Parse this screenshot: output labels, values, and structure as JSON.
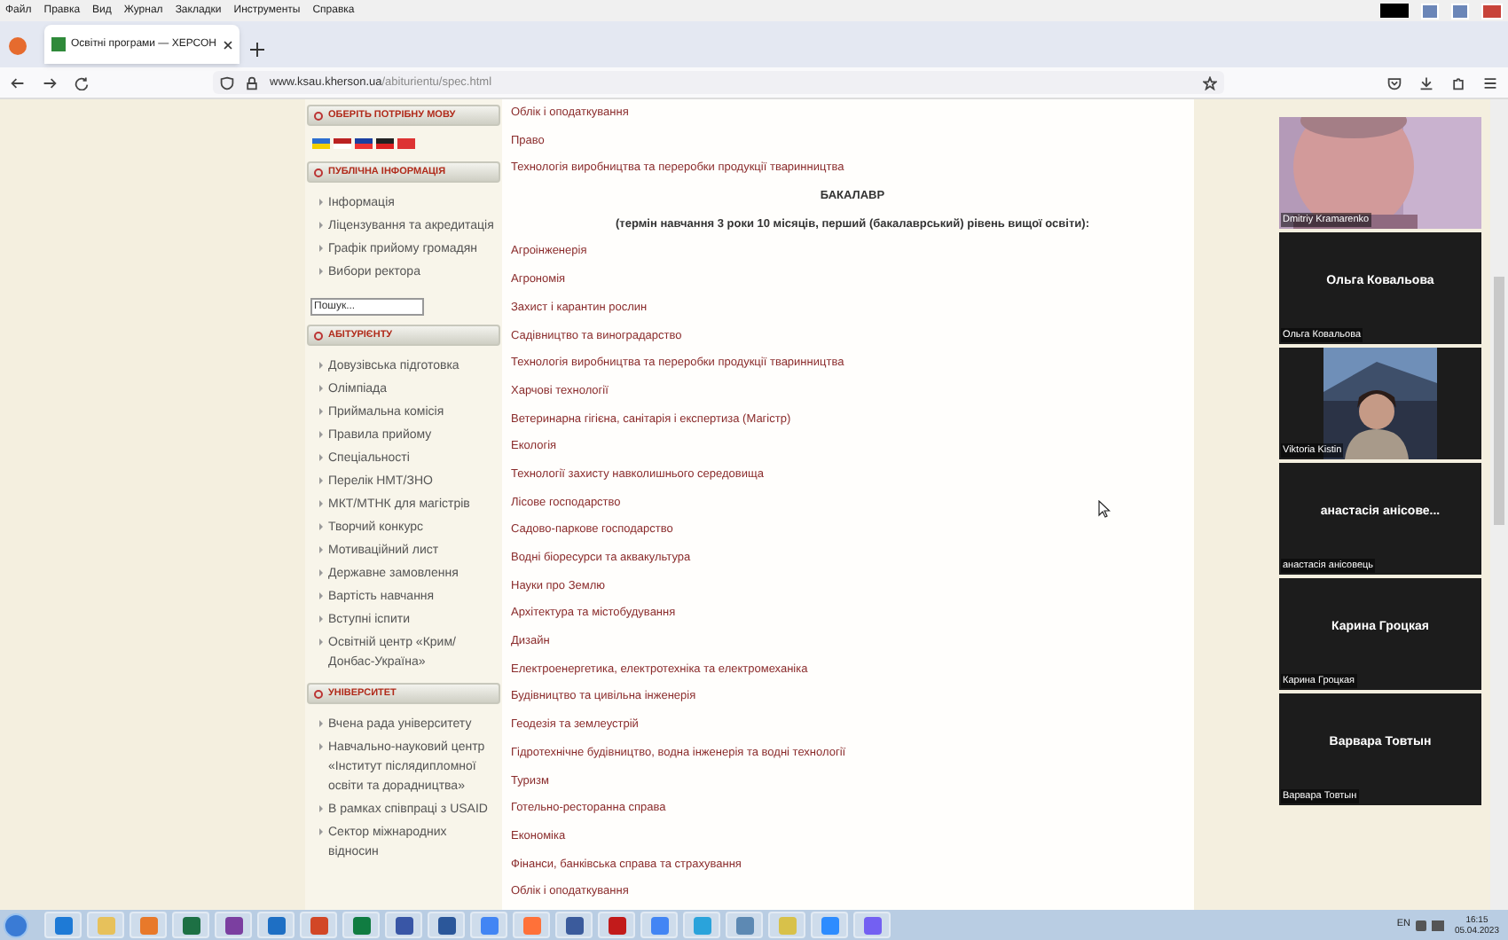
{
  "menu_bar": [
    "Файл",
    "Правка",
    "Вид",
    "Журнал",
    "Закладки",
    "Инструменты",
    "Справка"
  ],
  "tabs": [
    {
      "title": "Освітні програми — ХЕРСОН",
      "selected": true
    }
  ],
  "address_bar": {
    "host": "www.ksau.kherson.ua",
    "path": "/abiturientu/spec.html"
  },
  "sidebar": [
    {
      "kind": "flags",
      "heading": "ОБЕРІТЬ ПОТРІБНУ МОВУ"
    },
    {
      "kind": "list",
      "heading": "ПУБЛІЧНА ІНФОРМАЦІЯ",
      "items": [
        "Інформація",
        "Ліцензування та акредитація",
        "Графік прийому громадян",
        "Вибори ректора"
      ]
    },
    {
      "kind": "search",
      "placeholder": "Пошук..."
    },
    {
      "kind": "list",
      "heading": "АБІТУРІЄНТУ",
      "items": [
        "Довузівська підготовка",
        "Олімпіада",
        "Приймальна комісія",
        "Правила прийому",
        "Спеціальності",
        "Перелік НМТ/ЗНО",
        "МКТ/МТНК для магістрів",
        "Творчий конкурс",
        "Мотиваційний лист",
        "Державне замовлення",
        "Вартість навчання",
        "Вступні іспити",
        "Освітній центр «Крим/Донбас-Україна»"
      ]
    },
    {
      "kind": "list",
      "heading": "УНІВЕРСИТЕТ",
      "items": [
        "Вчена рада університету",
        "Навчально-науковий центр «Інститут післядипломної освіти та дорадництва»",
        "В рамках співпраці з USAID",
        "Сектор міжнародних відносин"
      ]
    }
  ],
  "content": [
    {
      "kind": "link",
      "text": "Облік і оподаткування"
    },
    {
      "kind": "link",
      "text": "Право"
    },
    {
      "kind": "link",
      "text": "Технологія виробництва та переробки продукції тваринництва"
    },
    {
      "kind": "heading",
      "text": "БАКАЛАВР"
    },
    {
      "kind": "heading",
      "text": "(термін навчання 3 роки 10 місяців, перший (бакалаврський) рівень вищої освіти):"
    },
    {
      "kind": "link",
      "text": "Агроінженерія"
    },
    {
      "kind": "link",
      "text": "Агрономія"
    },
    {
      "kind": "link",
      "text": "Захист і карантин рослин"
    },
    {
      "kind": "link",
      "text": "Садівництво та виноградарство"
    },
    {
      "kind": "link",
      "text": "Технологія виробництва та переробки продукції тваринництва"
    },
    {
      "kind": "link",
      "text": "Харчові технології"
    },
    {
      "kind": "link",
      "text": "Ветеринарна гігієна, санітарія і експертиза (Магістр)"
    },
    {
      "kind": "link",
      "text": "Екологія"
    },
    {
      "kind": "link",
      "text": "Технології захисту навколишнього середовища"
    },
    {
      "kind": "link",
      "text": "Лісове господарство"
    },
    {
      "kind": "link",
      "text": "Садово-паркове господарство"
    },
    {
      "kind": "link",
      "text": "Водні біоресурси та аквакультура"
    },
    {
      "kind": "link",
      "text": "Науки про Землю"
    },
    {
      "kind": "link",
      "text": "Архітектура та містобудування"
    },
    {
      "kind": "link",
      "text": "Дизайн"
    },
    {
      "kind": "link",
      "text": "Електроенергетика, електротехніка та електромеханіка"
    },
    {
      "kind": "link",
      "text": "Будівництво та цивільна інженерія"
    },
    {
      "kind": "link",
      "text": "Геодезія та землеустрій"
    },
    {
      "kind": "link",
      "text": "Гідротехнічне будівництво, водна інженерія та водні технології"
    },
    {
      "kind": "link",
      "text": "Туризм"
    },
    {
      "kind": "link",
      "text": "Готельно-ресторанна справа"
    },
    {
      "kind": "link",
      "text": "Економіка"
    },
    {
      "kind": "link",
      "text": "Фінанси, банківська справа та страхування"
    },
    {
      "kind": "link",
      "text": "Облік і оподаткування"
    }
  ],
  "participants": [
    {
      "kind": "video",
      "name": "Dmitriy Kramarenko"
    },
    {
      "kind": "avatar",
      "display": "Ольга Ковальова",
      "name": "Ольга Ковальова"
    },
    {
      "kind": "video",
      "name": "Viktoria Kistin"
    },
    {
      "kind": "avatar",
      "display": "анастасія анісове...",
      "name": "анастасія анісовець"
    },
    {
      "kind": "avatar",
      "display": "Карина Гроцкая",
      "name": "Карина Гроцкая"
    },
    {
      "kind": "avatar",
      "display": "Варвара Товтын",
      "name": "Варвара Товтын"
    }
  ],
  "tray": {
    "language": "EN",
    "time": "16:15",
    "date": "05.04.2023"
  }
}
